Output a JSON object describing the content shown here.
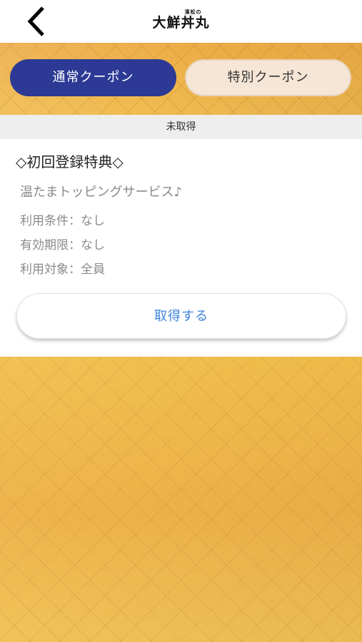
{
  "header": {
    "logo_small": "濱松の",
    "logo_main": "大鮮丼丸"
  },
  "tabs": [
    {
      "label": "通常クーポン",
      "active": true
    },
    {
      "label": "特別クーポン",
      "active": false
    }
  ],
  "status": {
    "label": "未取得"
  },
  "coupon": {
    "title": "◇初回登録特典◇",
    "description": "温たまトッピングサービス♪",
    "conditions": [
      "利用条件：なし",
      "有効期限：なし",
      "利用対象：全員"
    ],
    "action_label": "取得する"
  },
  "colors": {
    "tab_active": "#2c3a95",
    "tab_inactive": "#f5e6d6",
    "action_text": "#3c82db",
    "gold_background": "#edb54a"
  }
}
